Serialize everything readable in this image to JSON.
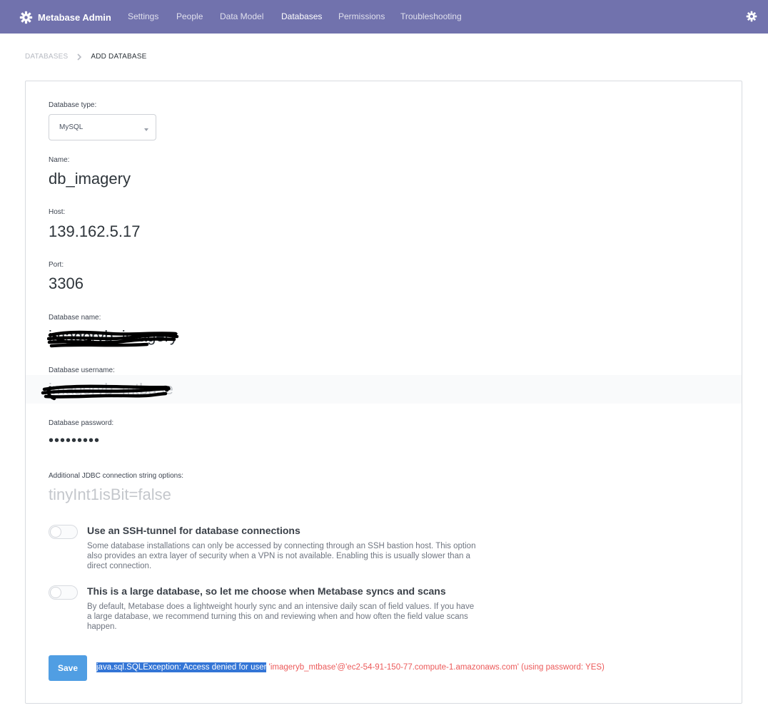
{
  "nav": {
    "brand": "Metabase Admin",
    "items": [
      {
        "label": "Settings",
        "active": false
      },
      {
        "label": "People",
        "active": false
      },
      {
        "label": "Data Model",
        "active": false
      },
      {
        "label": "Databases",
        "active": true
      },
      {
        "label": "Permissions",
        "active": false
      },
      {
        "label": "Troubleshooting",
        "active": false
      }
    ],
    "settings_icon": "gear-icon"
  },
  "breadcrumb": {
    "parent": "DATABASES",
    "separator_icon": "chevron-right-icon",
    "current": "ADD DATABASE"
  },
  "form": {
    "db_type": {
      "label": "Database type:",
      "value": "MySQL"
    },
    "name": {
      "label": "Name:",
      "value": "db_imagery"
    },
    "host": {
      "label": "Host:",
      "value": "139.162.5.17"
    },
    "port": {
      "label": "Port:",
      "value": "3306"
    },
    "db_name": {
      "label": "Database name:",
      "value": "imageryb_imagery"
    },
    "db_user": {
      "label": "Database username:",
      "value": "imageryb_mtbase"
    },
    "db_password": {
      "label": "Database password:",
      "value": "•••••••••"
    },
    "jdbc": {
      "label": "Additional JDBC connection string options:",
      "placeholder": "tinyInt1isBit=false"
    },
    "ssh": {
      "title": "Use an SSH-tunnel for database connections",
      "description": "Some database installations can only be accessed by connecting through an SSH bastion host. This option also provides an extra layer of security when a VPN is not available. Enabling this is usually slower than a direct connection.",
      "enabled": false
    },
    "large_db": {
      "title": "This is a large database, so let me choose when Metabase syncs and scans",
      "description": "By default, Metabase does a lightweight hourly sync and an intensive daily scan of field values. If you have a large database, we recommend turning this on and reviewing when and how often the field value scans happen.",
      "enabled": false
    },
    "save_label": "Save",
    "error_selected": "java.sql.SQLException: Access denied for user",
    "error_rest": " 'imageryb_mtbase'@'ec2-54-91-150-77.compute-1.amazonaws.com' (using password: YES)"
  },
  "colors": {
    "nav_bg": "#7172ad",
    "primary": "#509ee3",
    "error": "#ec5a5a",
    "selection": "#3375d6"
  }
}
